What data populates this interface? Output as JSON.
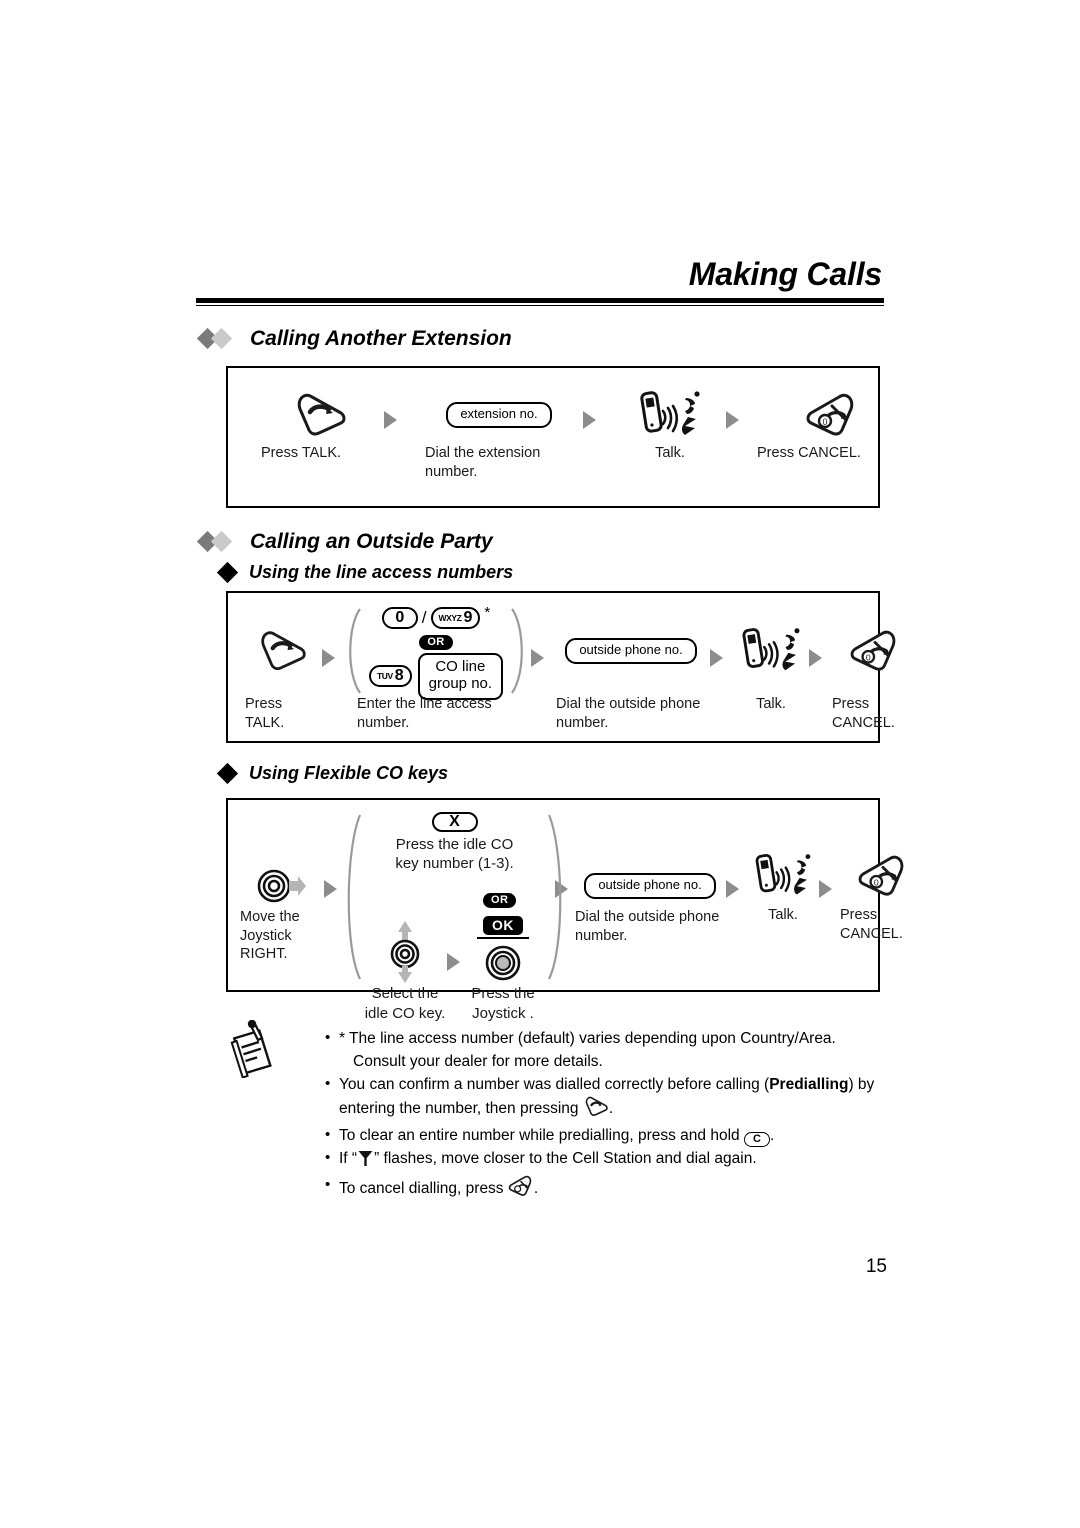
{
  "header": {
    "title": "Making Calls"
  },
  "sections": [
    {
      "id": "calling-another-extension",
      "heading": "Calling Another Extension",
      "steps": [
        {
          "icon": "talk-key-icon",
          "caption": "Press TALK."
        },
        {
          "icon": "extension-no-pill",
          "label": "extension no.",
          "caption": "Dial the extension number."
        },
        {
          "icon": "talking-handset-icon",
          "caption": "Talk."
        },
        {
          "icon": "cancel-key-icon",
          "caption": "Press CANCEL."
        }
      ]
    },
    {
      "id": "calling-an-outside-party",
      "heading": "Calling an Outside Party",
      "subsections": [
        {
          "id": "using-the-line-access-numbers",
          "heading": "Using the line access numbers",
          "steps": [
            {
              "icon": "talk-key-icon",
              "caption": "Press TALK."
            },
            {
              "icon": "line-access-group",
              "key_zero": "0",
              "slash": "/",
              "key_nine_letters": "WXYZ",
              "key_nine_digit": "9",
              "asterisk": "*",
              "or_badge": "OR",
              "key_eight_letters": "TUV",
              "key_eight_digit": "8",
              "co_line_box_line1": "CO line",
              "co_line_box_line2": "group no.",
              "caption": "Enter the line access number."
            },
            {
              "icon": "outside-phone-no-pill",
              "label": "outside phone no.",
              "caption": "Dial the outside phone number."
            },
            {
              "icon": "talking-handset-icon",
              "caption": "Talk."
            },
            {
              "icon": "cancel-key-icon",
              "caption": "Press CANCEL."
            }
          ]
        },
        {
          "id": "using-flexible-co-keys",
          "heading": "Using Flexible CO keys",
          "steps": [
            {
              "icon": "joystick-right-icon",
              "caption": "Move the Joystick RIGHT."
            },
            {
              "icon": "flexible-co-group",
              "key_x": "X",
              "press_idle_line1": "Press the idle CO",
              "press_idle_line2": "key number (1-3).",
              "or_badge": "OR",
              "ok_badge": "OK",
              "select_caption": "Select the idle CO key.",
              "press_caption": "Press the Joystick ."
            },
            {
              "icon": "outside-phone-no-pill",
              "label": "outside phone no.",
              "caption": "Dial the outside phone number."
            },
            {
              "icon": "talking-handset-icon",
              "caption": "Talk."
            },
            {
              "icon": "cancel-key-icon",
              "caption": "Press CANCEL."
            }
          ]
        }
      ]
    }
  ],
  "notes": {
    "icon": "memo-pencil-icon",
    "items": [
      {
        "text": "* The line access number (default) varies depending upon Country/Area.",
        "sub": false
      },
      {
        "text": "Consult your dealer for more details.",
        "sub": true
      },
      {
        "html": "You can confirm a number was dialled correctly before calling (<b>Predialling</b>) by entering the number, then pressing <span class=\"inline-ico\" data-name=\"talk-key-icon\"></span>.",
        "sub": false
      },
      {
        "html": "To clear an entire number while predialling, press and hold <span class=\"ckey\" data-name=\"clear-key-icon\">C</span>.",
        "sub": false
      },
      {
        "html": "If “<span class=\"inline-ico\" data-name=\"antenna-icon\"></span>” flashes, move closer to the Cell Station and dial again.",
        "sub": false
      },
      {
        "html": "To cancel dialling, press <span class=\"inline-ico\" data-name=\"cancel-key-icon\"></span>.",
        "sub": false
      }
    ]
  },
  "page_number": "15",
  "colors": {
    "arrow_gray": "#8c8c8c",
    "diamond_dark": "#7b7b7b",
    "diamond_light": "#c9c9c9",
    "rule_black": "#000000"
  }
}
